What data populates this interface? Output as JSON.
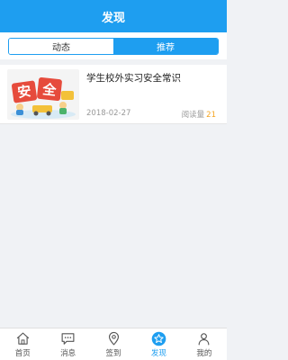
{
  "header": {
    "title": "发现"
  },
  "segment": {
    "tabs": [
      {
        "label": "动态",
        "active": false
      },
      {
        "label": "推荐",
        "active": true
      }
    ]
  },
  "articles": [
    {
      "title": "学生校外实习安全常识",
      "date": "2018-02-27",
      "reads_label": "阅读量",
      "reads_count": "21",
      "thumbnail_text": "安全"
    }
  ],
  "tabbar": {
    "items": [
      {
        "label": "首页",
        "icon": "home-icon"
      },
      {
        "label": "消息",
        "icon": "message-icon"
      },
      {
        "label": "签到",
        "icon": "location-pin-icon"
      },
      {
        "label": "发现",
        "icon": "star-icon",
        "active": true
      },
      {
        "label": "我的",
        "icon": "person-icon"
      }
    ]
  },
  "colors": {
    "accent": "#1e9ef0",
    "read_count": "#f5a623"
  }
}
